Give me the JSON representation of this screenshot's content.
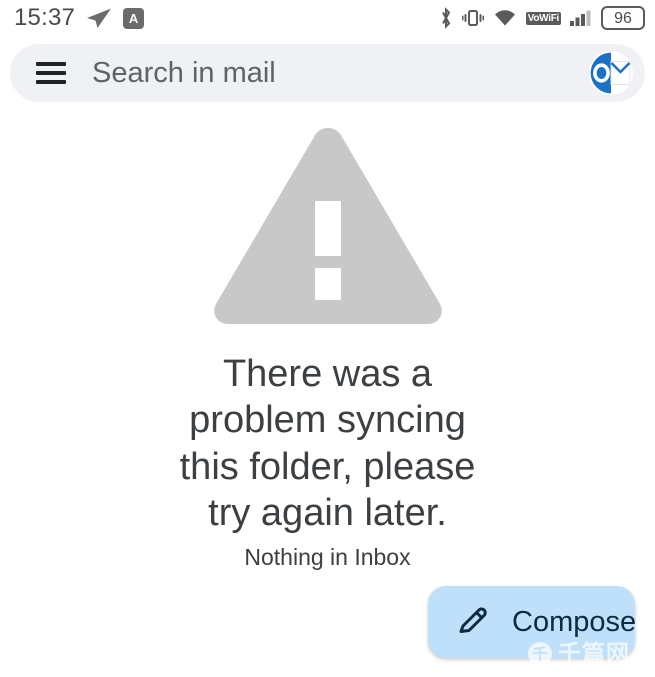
{
  "status_bar": {
    "time": "15:37",
    "left_icons": [
      "paper-plane-icon",
      "ime-keyboard-badge"
    ],
    "ime_badge_label": "A",
    "right_icons": [
      "bluetooth-icon",
      "vibrate-icon",
      "wifi-icon",
      "vowifi-badge",
      "cellular-signal-icon",
      "battery-level"
    ],
    "vowifi_label": "VoWiFi",
    "battery_level": "96",
    "icon_color": "#5a5a5a"
  },
  "search": {
    "placeholder": "Search in mail",
    "menu_icon": "hamburger-menu-icon",
    "avatar_icon": "outlook-account-avatar",
    "background": "#eff1f5",
    "text_color": "#5f6368"
  },
  "empty_state": {
    "icon": "warning-triangle-icon",
    "icon_color": "#c8c8c8",
    "title": "There was a problem syncing this folder, please try again later.",
    "subtitle": "Nothing in Inbox",
    "text_color": "#3c4043"
  },
  "compose_fab": {
    "label": "Compose",
    "icon": "pencil-edit-icon",
    "background": "#bfe0fa",
    "text_color": "#0d2a43"
  },
  "watermark": {
    "text": "千篇网",
    "logo_glyph": "千"
  }
}
